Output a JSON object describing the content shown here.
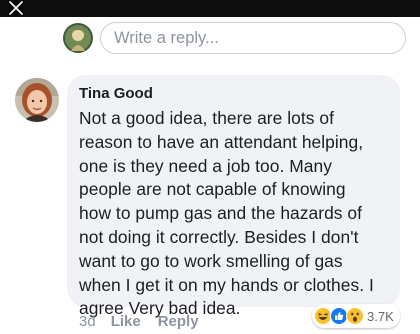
{
  "reply_box": {
    "placeholder": "Write a reply..."
  },
  "comment": {
    "author": "Tina Good",
    "lines": [
      "Not a good idea, there are lots of",
      "reason to have an attendant helping,",
      "one is they need a job too. Many",
      "people are not capable of knowing",
      "how to pump gas and the hazards of",
      "not doing it correctly. Besides I don't",
      "want to go to work smelling of gas",
      "when I get it on my hands or clothes. I",
      "agree Very bad idea."
    ],
    "time": "3d",
    "like_label": "Like",
    "reply_label": "Reply",
    "reactions": {
      "icons": [
        "haha-icon",
        "like-icon",
        "wow-icon"
      ],
      "count": "3.7K"
    }
  },
  "colors": {
    "topbar": "#0d0d0d",
    "bubble": "#f0f2f5",
    "muted_text": "#8d949e",
    "like_blue": "#1877f2",
    "reaction_yellow": "#f7c12f"
  }
}
